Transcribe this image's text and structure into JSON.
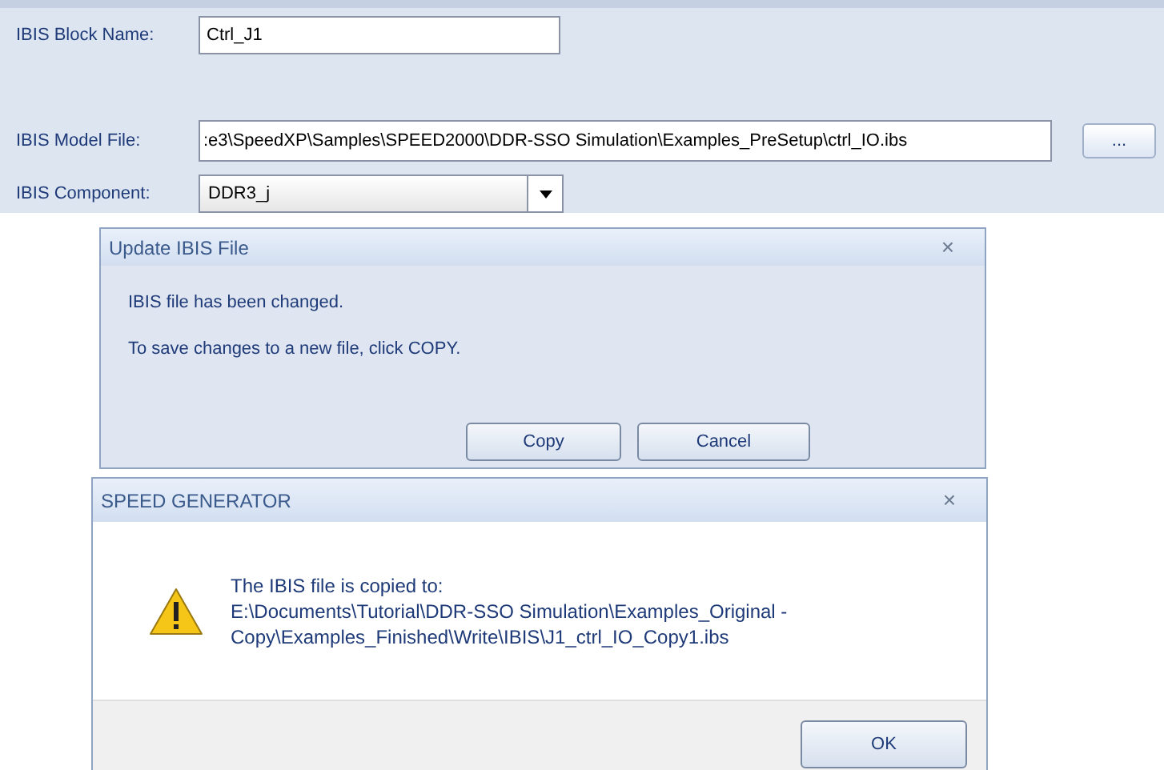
{
  "form": {
    "fields": [
      {
        "kind": "text",
        "label": "IBIS Block Name:",
        "value": "Ctrl_J1"
      },
      {
        "kind": "file",
        "label": "IBIS Model File:",
        "value": ":e3\\SpeedXP\\Samples\\SPEED2000\\DDR-SSO Simulation\\Examples_PreSetup\\ctrl_IO.ibs",
        "button": "..."
      },
      {
        "kind": "combo",
        "label": "IBIS Component:",
        "value": "DDR3_j"
      }
    ]
  },
  "update_dialog": {
    "title": "Update IBIS File",
    "close": "×",
    "messages": [
      "IBIS file has been changed.",
      "To save changes to a new file, click COPY."
    ],
    "buttons": [
      "Copy",
      "Cancel"
    ]
  },
  "generator_dialog": {
    "title": "SPEED GENERATOR",
    "close": "×",
    "message_lines": [
      "The IBIS file is copied to:",
      "E:\\Documents\\Tutorial\\DDR-SSO Simulation\\Examples_Original -",
      "Copy\\Examples_Finished\\Write\\IBIS\\J1_ctrl_IO_Copy1.ibs"
    ],
    "buttons": [
      "OK"
    ]
  }
}
